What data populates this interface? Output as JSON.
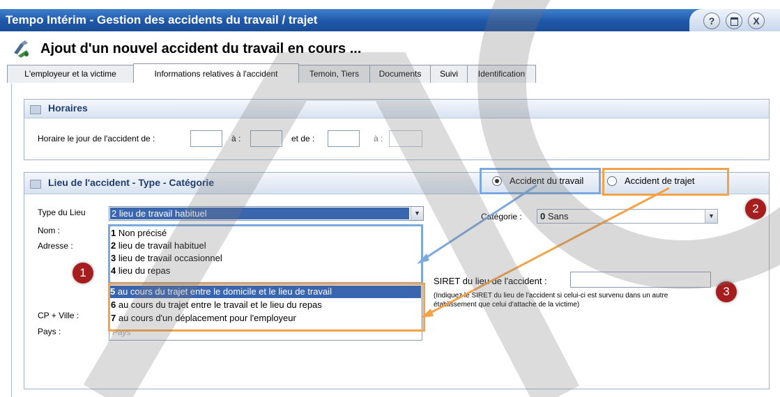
{
  "window": {
    "title": "Tempo Intérim - Gestion des accidents du travail / trajet",
    "help_label": "?",
    "close_label": "X"
  },
  "heading": "Ajout d'un nouvel accident du travail en cours ...",
  "tabs": [
    {
      "label": "L'employeur et la victime"
    },
    {
      "label": "Informations relatives à l'accident"
    },
    {
      "label": "Temoin, Tiers"
    },
    {
      "label": "Documents"
    },
    {
      "label": "Suivi"
    },
    {
      "label": "Identification"
    }
  ],
  "horaires": {
    "title": "Horaires",
    "label_day": "Horaire le jour de l'accident de :",
    "label_a1": "à :",
    "label_et_de": "et de :",
    "label_a2": "à :"
  },
  "lieu": {
    "title": "Lieu de l'accident - Type - Catégorie",
    "radio_travail": "Accident du travail",
    "radio_trajet": "Accident de trajet",
    "type_label": "Type du Lieu",
    "type_selected_num": "2",
    "type_selected_text": " lieu de travail habituel",
    "nom_label": "Nom :",
    "adresse_label": "Adresse :",
    "cp_label": "CP + Ville :",
    "pays_label": "Pays :",
    "pays_placeholder": "Pays",
    "categorie_label": "Catégorie :",
    "categorie_num": "0",
    "categorie_text": " Sans",
    "siret_label": "SIRET du lieu de l'accident :",
    "siret_help": "(Indiquez le SIRET du lieu de l'accident si celui-ci est survenu dans un autre établissement que celui d'attache de la victime)"
  },
  "dropdown_options": [
    {
      "num": "1",
      "text": " Non précisé"
    },
    {
      "num": "2",
      "text": " lieu de travail habituel"
    },
    {
      "num": "3",
      "text": " lieu de travail occasionnel"
    },
    {
      "num": "4",
      "text": " lieu du repas"
    },
    {
      "num": "5",
      "text": " au cours du trajet entre le domicile et le lieu de travail"
    },
    {
      "num": "6",
      "text": " au cours du trajet entre le travail et le lieu du repas"
    },
    {
      "num": "7",
      "text": " au cours d'un déplacement pour l'employeur"
    }
  ],
  "badges": [
    "1",
    "2",
    "3"
  ],
  "colors": {
    "title_bar": "#1f57a8",
    "highlight_blue": "#7ba9de",
    "highlight_orange": "#f4a24a",
    "badge": "#a61d1d",
    "selected_row": "#3a66b0"
  }
}
